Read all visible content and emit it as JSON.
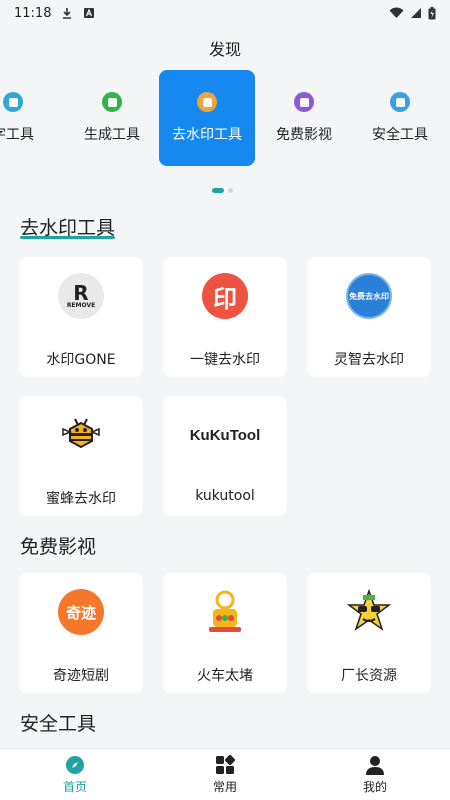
{
  "status_bar": {
    "time": "11:18"
  },
  "page": {
    "title": "发现"
  },
  "categories": [
    {
      "label": "字工具",
      "icon_color": "#2fa8d8",
      "icon": "tool-icon"
    },
    {
      "label": "生成工具",
      "icon_color": "#2fb54a",
      "icon": "generate-icon"
    },
    {
      "label": "去水印工具",
      "icon_color": "#f0a23b",
      "icon": "eraser-icon",
      "active": true
    },
    {
      "label": "免费影视",
      "icon_color": "#8b5bd6",
      "icon": "film-icon"
    },
    {
      "label": "安全工具",
      "icon_color": "#3a9fe8",
      "icon": "shield-icon"
    }
  ],
  "sections": [
    {
      "title": "去水印工具",
      "items": [
        {
          "name": "水印GONE",
          "logo_text": "R",
          "logo_sub": "REMOVE",
          "logo_bg": "#e9e9e9",
          "logo_fg": "#222"
        },
        {
          "name": "一键去水印",
          "logo_text": "印",
          "logo_bg": "#ee5341",
          "logo_fg": "#fff"
        },
        {
          "name": "灵智去水印",
          "logo_text": "免费去水印",
          "logo_bg": "#2c7fd9",
          "logo_fg": "#fff"
        },
        {
          "name": "蜜蜂去水印",
          "logo_text": "🐝",
          "logo_bg": "#ffffff",
          "logo_fg": "#222"
        },
        {
          "name": "kukutool",
          "logo_text": "KuKuTool",
          "logo_bg": "#ffffff",
          "logo_fg": "#222"
        }
      ]
    },
    {
      "title": "免费影视",
      "items": [
        {
          "name": "奇迹短剧",
          "logo_text": "奇迹",
          "logo_bg": "#f5782a",
          "logo_fg": "#fff"
        },
        {
          "name": "火车太堵",
          "logo_text": "",
          "logo_bg": "#ffffff",
          "logo_fg": "#222"
        },
        {
          "name": "厂长资源",
          "logo_text": "",
          "logo_bg": "#ffffff",
          "logo_fg": "#222"
        }
      ]
    },
    {
      "title": "安全工具",
      "items": []
    }
  ],
  "bottom_nav": [
    {
      "label": "首页",
      "icon": "compass-icon",
      "active": true
    },
    {
      "label": "常用",
      "icon": "grid-icon"
    },
    {
      "label": "我的",
      "icon": "user-icon"
    }
  ],
  "colors": {
    "accent": "#1fa3a3",
    "active_tab_bg": "#1589f0"
  }
}
